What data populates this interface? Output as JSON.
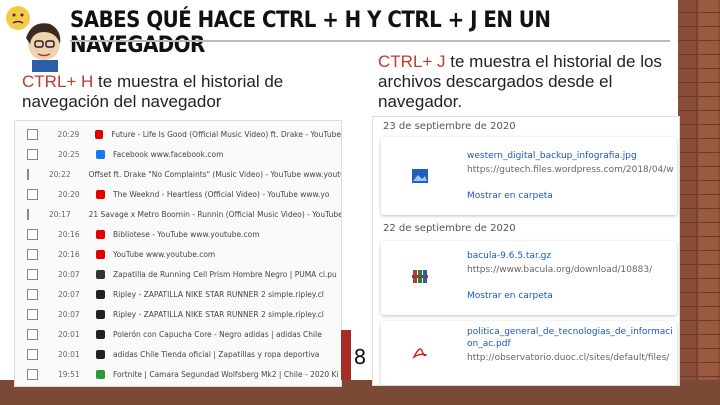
{
  "slide": {
    "title": "SABES QUÉ HACE CTRL + H Y CTRL + J EN UN NAVEGADOR",
    "page_number": "8",
    "colors": {
      "accent": "#c0392b",
      "link": "#1a56c9",
      "brick": "#7b4a36"
    }
  },
  "left": {
    "key": "CTRL+ H",
    "text": " te muestra el historial de navegación del navegador"
  },
  "right": {
    "key": "CTRL+ J",
    "text": " te muestra el historial de los archivos descargados desde el navegador."
  },
  "history": {
    "rows": [
      {
        "time": "20:29",
        "icon": "youtube-icon",
        "color": "#e00000",
        "text": "Future - Life Is Good (Official Music Video) ft. Drake - YouTube"
      },
      {
        "time": "20:25",
        "icon": "facebook-icon",
        "color": "#1877f2",
        "text": "Facebook    www.facebook.com"
      },
      {
        "time": "20:22",
        "icon": "youtube-icon",
        "color": "#e00000",
        "text": "Offset ft. Drake \"No Complaints\" (Music Video) - YouTube    www.youtube"
      },
      {
        "time": "20:20",
        "icon": "youtube-icon",
        "color": "#e00000",
        "text": "The Weeknd - Heartless (Official Video) - YouTube    www.yo"
      },
      {
        "time": "20:17",
        "icon": "youtube-icon",
        "color": "#e00000",
        "text": "21 Savage x Metro Boomin - Runnin (Official Music Video) - YouTube"
      },
      {
        "time": "20:16",
        "icon": "youtube-icon",
        "color": "#e00000",
        "text": "Bibliotese - YouTube    www.youtube.com"
      },
      {
        "time": "20:16",
        "icon": "youtube-icon",
        "color": "#e00000",
        "text": "YouTube    www.youtube.com"
      },
      {
        "time": "20:07",
        "icon": "puma-icon",
        "color": "#333333",
        "text": "Zapatilla de Running Cell Prism Hombre Negro | PUMA    cl.pu"
      },
      {
        "time": "20:07",
        "icon": "ripley-icon",
        "color": "#222222",
        "text": "Ripley - ZAPATILLA NIKE STAR RUNNER 2    simple.ripley.cl"
      },
      {
        "time": "20:07",
        "icon": "ripley-icon",
        "color": "#222222",
        "text": "Ripley - ZAPATILLA NIKE STAR RUNNER 2    simple.ripley.cl"
      },
      {
        "time": "20:01",
        "icon": "adidas-icon",
        "color": "#222222",
        "text": "Polerón con Capucha Core - Negro adidas | adidas Chile"
      },
      {
        "time": "20:01",
        "icon": "adidas-icon",
        "color": "#222222",
        "text": "adidas Chile Tienda oficial | Zapatillas y ropa deportiva"
      },
      {
        "time": "19:51",
        "icon": "green-icon",
        "color": "#2e9b3a",
        "text": "Fortnite | Camara Segundad Wolfsberg Mk2 | Chile - 2020 Ki"
      }
    ]
  },
  "downloads": {
    "groups": [
      {
        "date": "23 de septiembre de 2020",
        "name": "western_digital_backup_infografia.jpg",
        "url": "https://gutech.files.wordpress.com/2018/04/w",
        "link": "Mostrar en carpeta",
        "icon": "image-file-icon"
      },
      {
        "date": "22 de septiembre de 2020",
        "name": "bacula-9.6.5.tar.gz",
        "url": "https://www.bacula.org/download/10883/",
        "link": "Mostrar en carpeta",
        "icon": "archive-file-icon"
      },
      {
        "date": "",
        "name": "politica_general_de_tecnologias_de_informaci",
        "name2": "on_ac.pdf",
        "url": "http://observatorio.duoc.cl/sites/default/files/",
        "link": "Mostrar en carpeta",
        "icon": "pdf-file-icon"
      }
    ]
  }
}
